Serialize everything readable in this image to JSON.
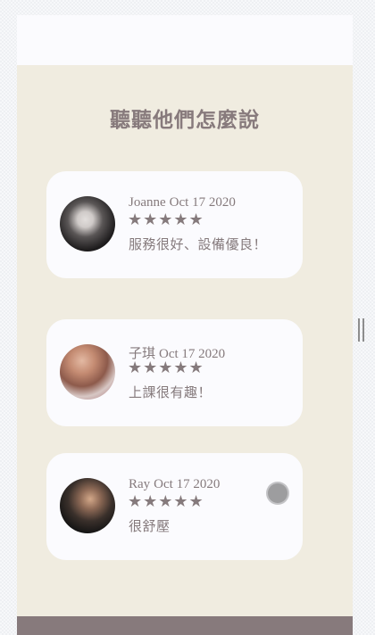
{
  "section": {
    "title": "聽聽他們怎麼說"
  },
  "reviews": [
    {
      "name": "Joanne",
      "date": "Oct 17 2020",
      "stars": "★★★★★",
      "rating": 5,
      "comment": "服務很好、設備優良！",
      "avatar_icon": "user-avatar-photo"
    },
    {
      "name": "子琪",
      "date": "Oct 17 2020",
      "stars": "★★★★★",
      "rating": 5,
      "comment": "上課很有趣！",
      "avatar_icon": "user-avatar-photo"
    },
    {
      "name": "Ray",
      "date": "Oct 17 2020",
      "stars": "★★★★★",
      "rating": 5,
      "comment": "很舒壓",
      "avatar_icon": "user-avatar-photo"
    }
  ],
  "colors": {
    "accent": "#877a7c",
    "panel_background": "#f0ece0",
    "card_background": "#fbfbfe"
  }
}
